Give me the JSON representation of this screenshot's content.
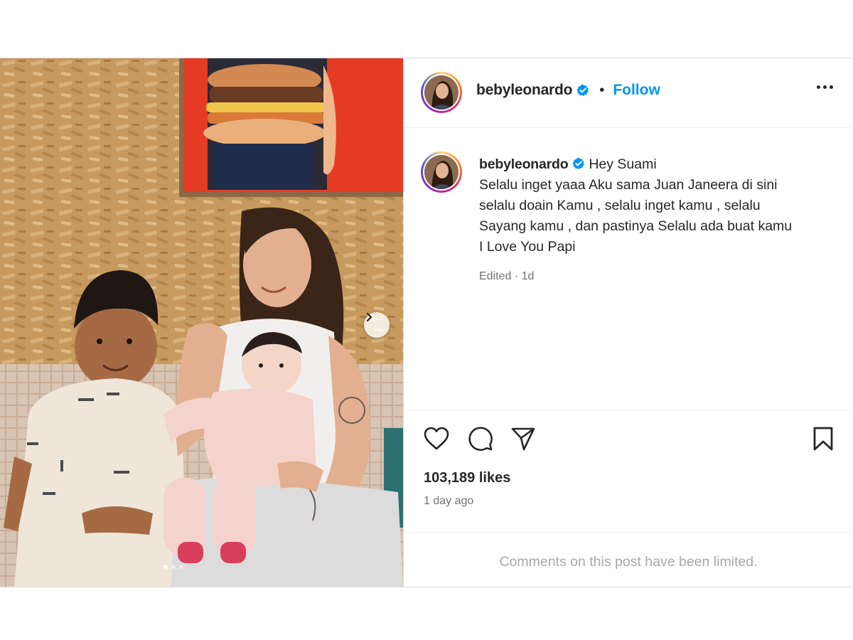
{
  "post": {
    "username": "bebyleonardo",
    "follow_label": "Follow",
    "separator": "•",
    "caption": {
      "username": "bebyleonardo",
      "first_line": "Hey Suami",
      "lines": [
        "Selalu inget yaaa Aku sama Juan Janeera di sini",
        "selalu doain Kamu , selalu inget kamu , selalu",
        "Sayang kamu , dan pastinya Selalu ada buat kamu",
        "I Love You Papi"
      ],
      "meta": "Edited · 1d"
    },
    "likes": "103,189 likes",
    "time": "1 day ago",
    "comments_notice": "Comments on this post have been limited.",
    "icons": {
      "verified": "verified-badge-icon",
      "more": "more-options-icon",
      "like": "heart-icon",
      "comment": "comment-icon",
      "share": "send-icon",
      "save": "bookmark-icon",
      "next": "chevron-right-icon"
    },
    "colors": {
      "accent": "#0095f6",
      "text": "#262626",
      "muted": "#737373",
      "limited": "#a8a8a8"
    }
  }
}
